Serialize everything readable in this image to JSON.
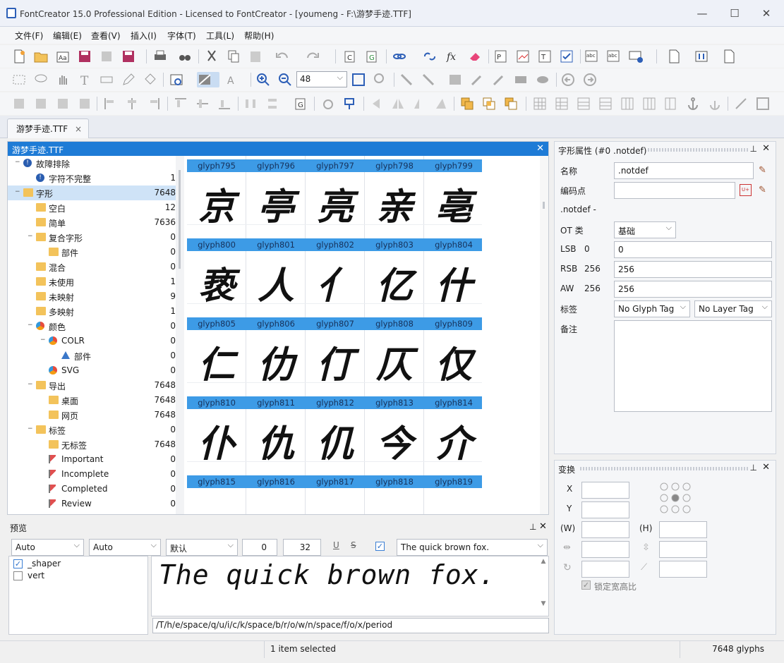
{
  "window": {
    "title": "FontCreator 15.0 Professional Edition - Licensed to FontCreator - [youmeng - F:\\游梦手迹.TTF]",
    "minimize": "—",
    "maximize": "☐",
    "close": "✕"
  },
  "menu": [
    "文件(F)",
    "编辑(E)",
    "查看(V)",
    "插入(I)",
    "字体(T)",
    "工具(L)",
    "帮助(H)"
  ],
  "toolbar": {
    "zoom_value": "48"
  },
  "tabs": [
    {
      "label": "游梦手迹.TTF",
      "close": "×"
    }
  ],
  "font_panel": {
    "title": "游梦手迹.TTF",
    "close": "✕",
    "tree": [
      {
        "label": "故障排除",
        "count": "",
        "indent": 0,
        "icon": "warning-icon",
        "expander": "−"
      },
      {
        "label": "字符不完整",
        "count": "1",
        "indent": 1,
        "icon": "warning-icon",
        "expander": ""
      },
      {
        "label": "字形",
        "count": "7648",
        "indent": 0,
        "icon": "folder-icon",
        "expander": "−",
        "selected": true
      },
      {
        "label": "空白",
        "count": "12",
        "indent": 1,
        "icon": "folder-icon",
        "expander": ""
      },
      {
        "label": "简单",
        "count": "7636",
        "indent": 1,
        "icon": "folder-icon",
        "expander": ""
      },
      {
        "label": "复合字形",
        "count": "0",
        "indent": 1,
        "icon": "folder-icon",
        "expander": "−"
      },
      {
        "label": "部件",
        "count": "0",
        "indent": 2,
        "icon": "folder-icon",
        "expander": ""
      },
      {
        "label": "混合",
        "count": "0",
        "indent": 1,
        "icon": "folder-icon",
        "expander": ""
      },
      {
        "label": "未使用",
        "count": "1",
        "indent": 1,
        "icon": "folder-icon",
        "expander": ""
      },
      {
        "label": "未映射",
        "count": "9",
        "indent": 1,
        "icon": "folder-icon",
        "expander": ""
      },
      {
        "label": "多映射",
        "count": "1",
        "indent": 1,
        "icon": "folder-icon",
        "expander": ""
      },
      {
        "label": "颜色",
        "count": "0",
        "indent": 1,
        "icon": "color-icon",
        "expander": "−"
      },
      {
        "label": "COLR",
        "count": "0",
        "indent": 2,
        "icon": "color-icon",
        "expander": "−"
      },
      {
        "label": "部件",
        "count": "0",
        "indent": 3,
        "icon": "triangle-icon",
        "expander": ""
      },
      {
        "label": "SVG",
        "count": "0",
        "indent": 2,
        "icon": "color-icon",
        "expander": ""
      },
      {
        "label": "导出",
        "count": "7648",
        "indent": 1,
        "icon": "folder-icon",
        "expander": "−"
      },
      {
        "label": "桌面",
        "count": "7648",
        "indent": 2,
        "icon": "folder-icon",
        "expander": ""
      },
      {
        "label": "网页",
        "count": "7648",
        "indent": 2,
        "icon": "folder-icon",
        "expander": ""
      },
      {
        "label": "标签",
        "count": "0",
        "indent": 1,
        "icon": "folder-icon",
        "expander": "−"
      },
      {
        "label": "无标签",
        "count": "7648",
        "indent": 2,
        "icon": "folder-icon",
        "expander": ""
      },
      {
        "label": "Important",
        "count": "0",
        "indent": 2,
        "icon": "flag-icon",
        "expander": ""
      },
      {
        "label": "Incomplete",
        "count": "0",
        "indent": 2,
        "icon": "flag-icon",
        "expander": ""
      },
      {
        "label": "Completed",
        "count": "0",
        "indent": 2,
        "icon": "flag-icon",
        "expander": ""
      },
      {
        "label": "Review",
        "count": "0",
        "indent": 2,
        "icon": "flag-icon",
        "expander": ""
      }
    ],
    "glyph_rows": [
      [
        {
          "name": "glyph795",
          "char": ""
        },
        {
          "name": "glyph796",
          "char": ""
        },
        {
          "name": "glyph797",
          "char": ""
        },
        {
          "name": "glyph798",
          "char": ""
        },
        {
          "name": "glyph799",
          "char": ""
        }
      ],
      [
        {
          "name": "glyph800",
          "char": "京"
        },
        {
          "name": "glyph801",
          "char": "亭"
        },
        {
          "name": "glyph802",
          "char": "亮"
        },
        {
          "name": "glyph803",
          "char": "亲"
        },
        {
          "name": "glyph804",
          "char": "亳"
        }
      ],
      [
        {
          "name": "glyph805",
          "char": "亵"
        },
        {
          "name": "glyph806",
          "char": "人"
        },
        {
          "name": "glyph807",
          "char": "亻"
        },
        {
          "name": "glyph808",
          "char": "亿"
        },
        {
          "name": "glyph809",
          "char": "什"
        }
      ],
      [
        {
          "name": "glyph810",
          "char": "仁"
        },
        {
          "name": "glyph811",
          "char": "仂"
        },
        {
          "name": "glyph812",
          "char": "仃"
        },
        {
          "name": "glyph813",
          "char": "仄"
        },
        {
          "name": "glyph814",
          "char": "仅"
        }
      ],
      [
        {
          "name": "glyph815",
          "char": "仆"
        },
        {
          "name": "glyph816",
          "char": "仇"
        },
        {
          "name": "glyph817",
          "char": "仉"
        },
        {
          "name": "glyph818",
          "char": "今"
        },
        {
          "name": "glyph819",
          "char": "介"
        }
      ]
    ]
  },
  "preview": {
    "title": "预览",
    "script_select": "Auto",
    "lang_select": "Auto",
    "feature_select": "默认",
    "spacing_value": "0",
    "size_value": "32",
    "underline": "U",
    "strike": "S",
    "text_select": "The quick brown fox.",
    "features": [
      {
        "label": "_shaper",
        "checked": true
      },
      {
        "label": "vert",
        "checked": false
      }
    ],
    "sample_text": "The quick brown fox.",
    "glyph_string": "/T/h/e/space/q/u/i/c/k/space/b/r/o/w/n/space/f/o/x/period"
  },
  "glyph_props": {
    "title": "字形属性 (#0 .notdef)",
    "name_label": "名称",
    "name_value": ".notdef",
    "codepoint_label": "编码点",
    "codepoint_value": "",
    "unicode_badge": "U+",
    "glyph_desc": ".notdef -",
    "ot_class_label": "OT 类",
    "ot_class_value": "基础",
    "lsb_label": "LSB",
    "lsb_value": "0",
    "lsb_input": "0",
    "rsb_label": "RSB",
    "rsb_value": "256",
    "rsb_input": "256",
    "aw_label": "AW",
    "aw_value": "256",
    "aw_input": "256",
    "tag_label": "标签",
    "glyph_tag": "No Glyph Tag",
    "layer_tag": "No Layer Tag",
    "note_label": "备注",
    "note_value": ""
  },
  "transform": {
    "title": "变换",
    "x_label": "X",
    "y_label": "Y",
    "w_label": "(W)",
    "h_label": "(H)",
    "lock_ratio": "锁定宽高比"
  },
  "status": {
    "selection": "1 item selected",
    "glyph_count": "7648 glyphs"
  },
  "colors": {
    "accent": "#1e7bd6",
    "glyph_label_bg": "#3d9be6",
    "tree_selected": "#cfe3f7"
  }
}
